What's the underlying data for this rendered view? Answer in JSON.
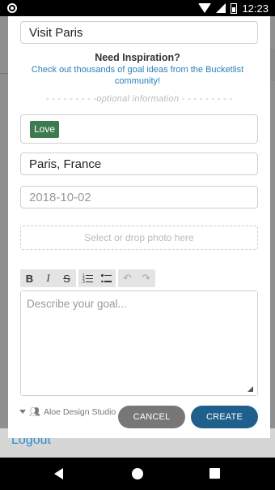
{
  "status_bar": {
    "time": "12:23",
    "icons": [
      "notification-dot-icon",
      "wifi-icon",
      "cell-signal-icon",
      "battery-icon"
    ]
  },
  "modal": {
    "title_input": {
      "value": "Visit Paris",
      "placeholder": ""
    },
    "inspiration": {
      "heading": "Need Inspiration?",
      "text": "Check out thousands of goal ideas from the Bucketlist community!"
    },
    "optional_divider": "- - - - - - - - -optional information - - - - - - - - -",
    "tags": [
      {
        "label": "Love",
        "color": "#3d7a4d"
      }
    ],
    "location_input": {
      "value": "Paris, France"
    },
    "date_input": {
      "placeholder": "2018-10-02"
    },
    "photo_drop": {
      "label": "Select or drop photo here"
    },
    "toolbar": {
      "bold": "B",
      "italic": "I",
      "strikethrough": "S"
    },
    "description": {
      "placeholder": "Describe your goal..."
    },
    "studio_label": "Aloe Design Studio",
    "cancel_label": "CANCEL",
    "create_label": "CREATE"
  },
  "background": {
    "logout_label": "Logout"
  },
  "colors": {
    "accent": "#1e5f8c",
    "link": "#2a7fbb",
    "tag": "#3d7a4d",
    "cancel": "#777777"
  }
}
